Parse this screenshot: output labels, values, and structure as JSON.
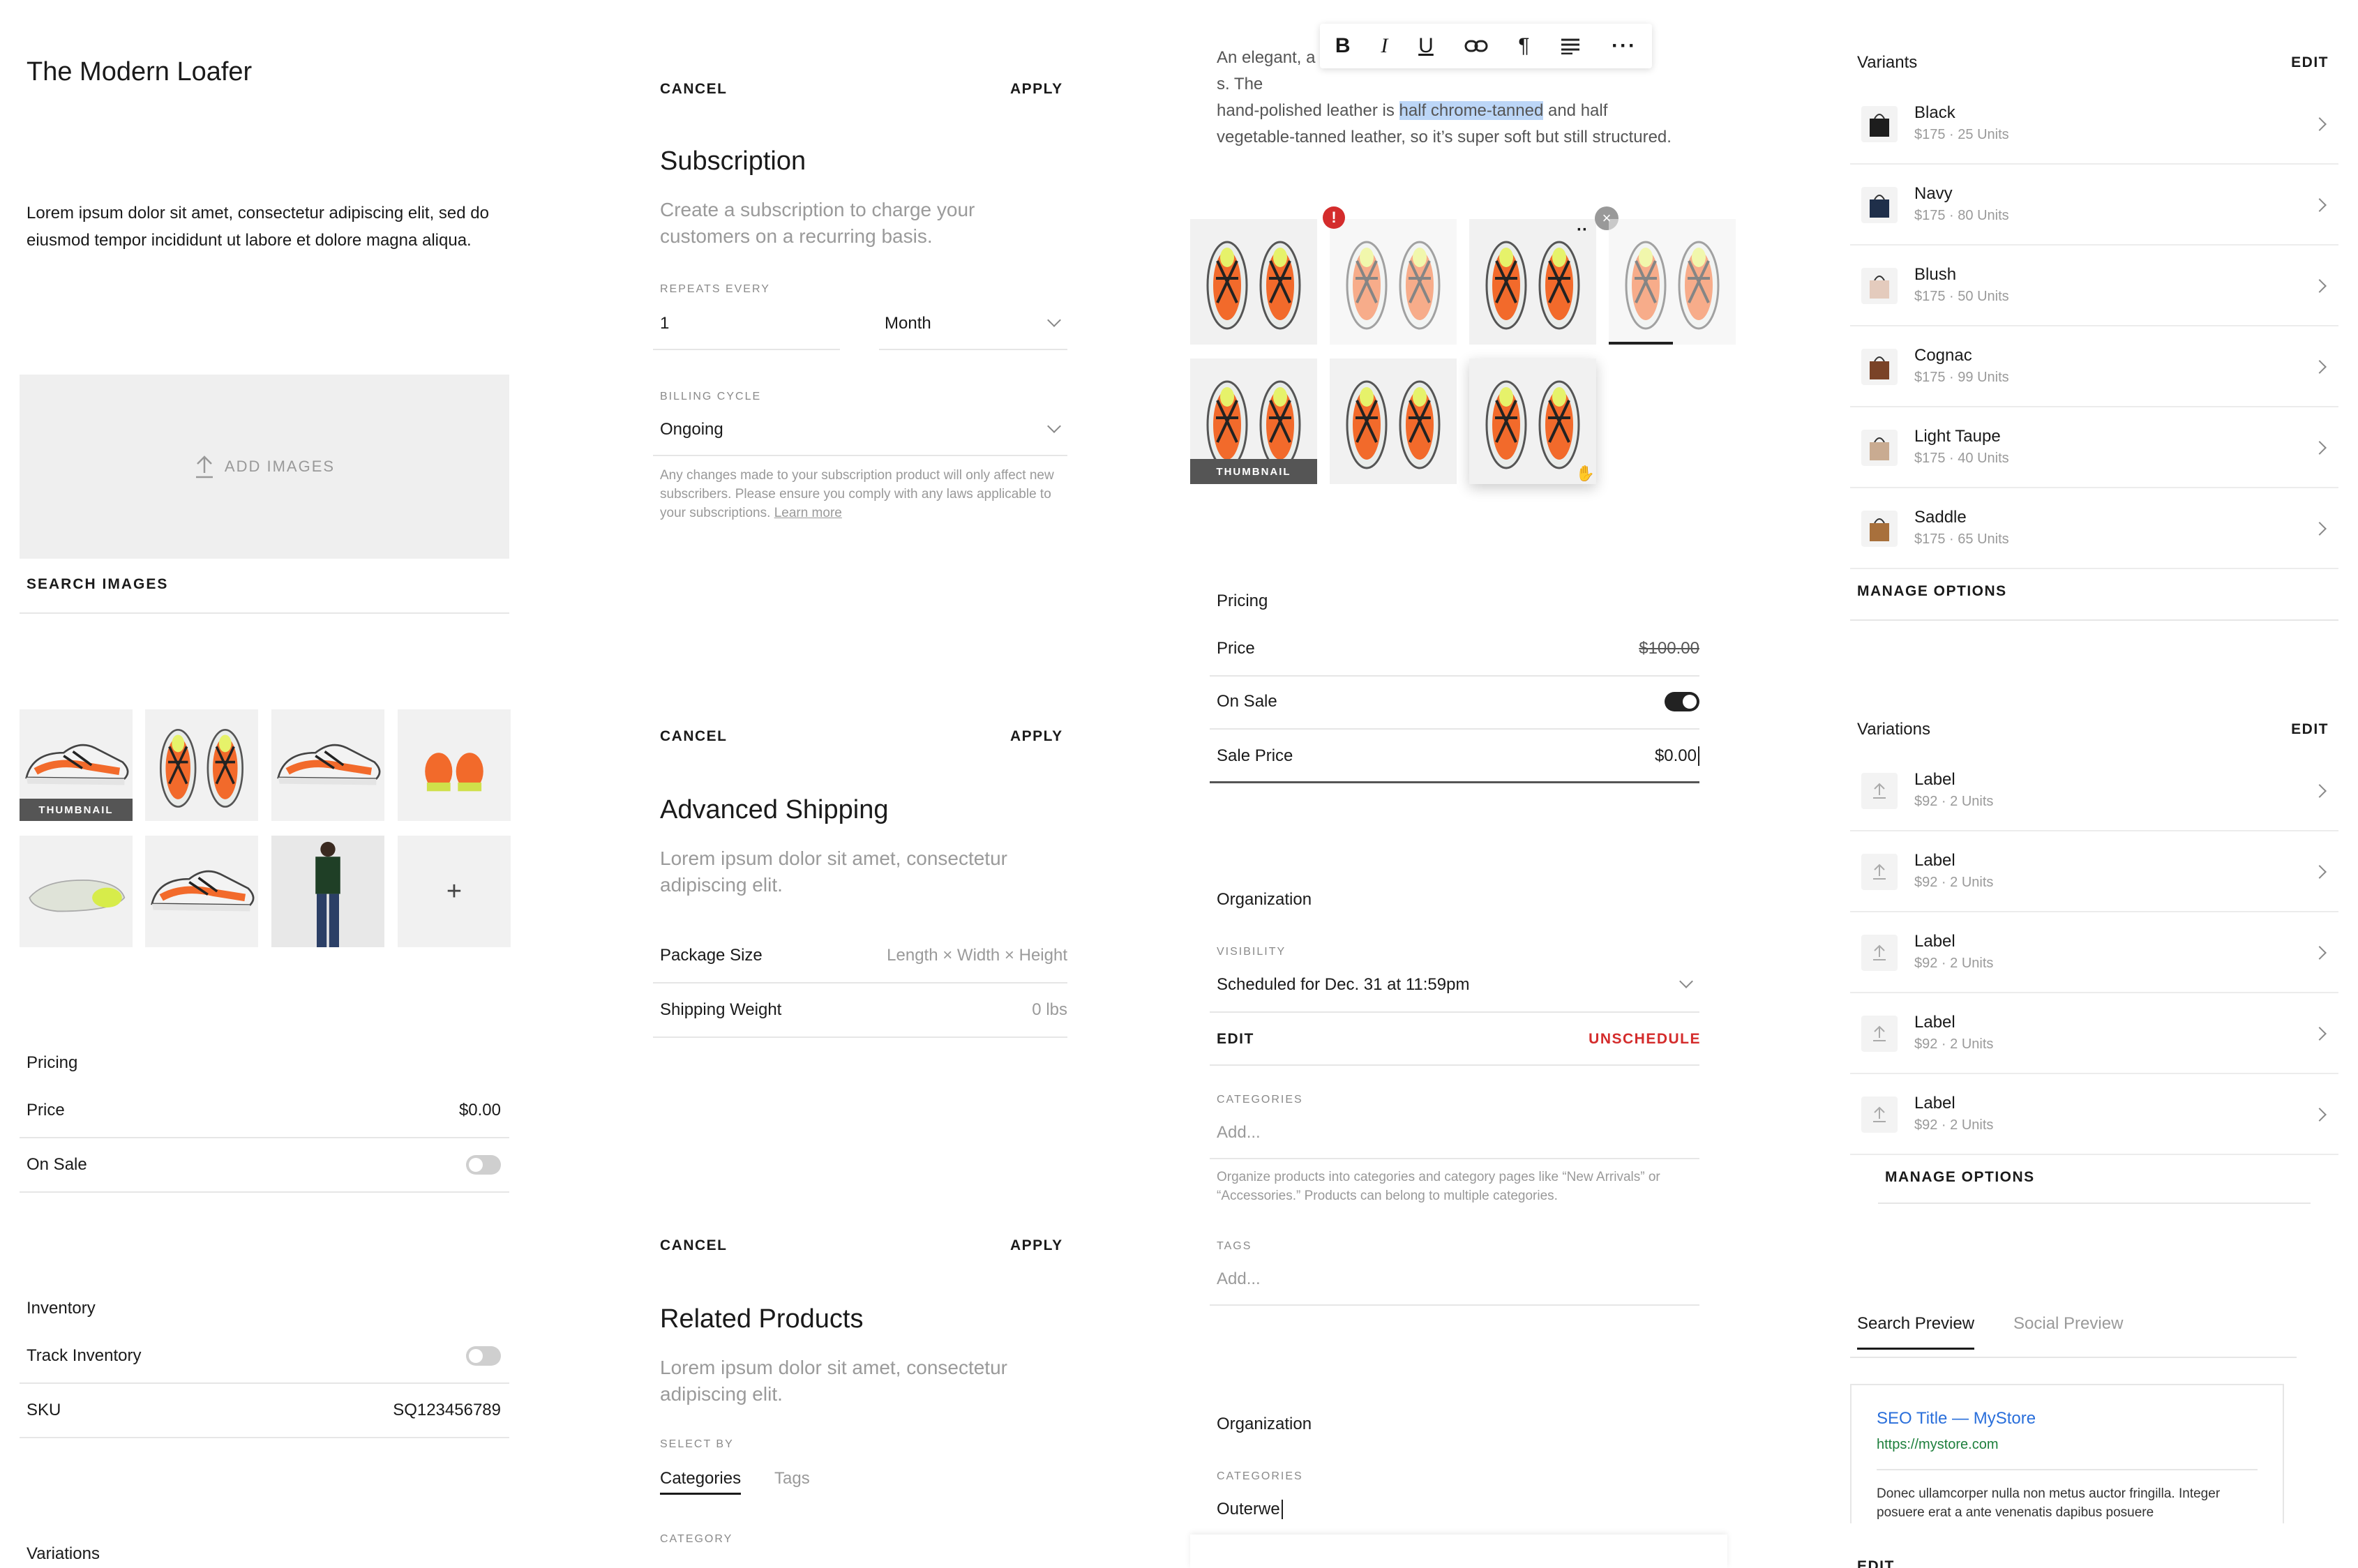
{
  "col1": {
    "title": "The Modern Loafer",
    "description": "Lorem ipsum dolor sit amet, consectetur adipiscing elit, sed do eiusmod tempor incididunt ut labore et dolore magna aliqua.",
    "add_images": "ADD IMAGES",
    "search_images": "SEARCH IMAGES",
    "thumbnail_label": "THUMBNAIL",
    "add_tile": "+",
    "pricing": {
      "heading": "Pricing",
      "price_label": "Price",
      "price_value": "$0.00",
      "on_sale_label": "On Sale",
      "on_sale": false
    },
    "inventory": {
      "heading": "Inventory",
      "track_label": "Track Inventory",
      "track": false,
      "sku_label": "SKU",
      "sku_value": "SQ123456789"
    },
    "variations_heading": "Variations"
  },
  "col2": {
    "subscription": {
      "cancel": "CANCEL",
      "apply": "APPLY",
      "title": "Subscription",
      "subtitle": "Create a subscription to charge your customers on a recurring basis.",
      "repeats_label": "REPEATS EVERY",
      "repeats_value": "1",
      "period": "Month",
      "billing_label": "BILLING CYCLE",
      "billing_value": "Ongoing",
      "notice": "Any changes made to your subscription product will only affect new subscribers. Please ensure you comply with any laws applicable to your subscriptions.",
      "learn_more": "Learn more"
    },
    "shipping": {
      "cancel": "CANCEL",
      "apply": "APPLY",
      "title": "Advanced Shipping",
      "subtitle": "Lorem ipsum dolor sit amet, consectetur adipiscing elit.",
      "package_label": "Package Size",
      "package_placeholder": "Length × Width × Height",
      "weight_label": "Shipping Weight",
      "weight_placeholder": "0 lbs"
    },
    "related": {
      "cancel": "CANCEL",
      "apply": "APPLY",
      "title": "Related Products",
      "subtitle": "Lorem ipsum dolor sit amet, consectetur adipiscing elit.",
      "select_by_label": "SELECT BY",
      "tabs": [
        "Categories",
        "Tags"
      ],
      "category_label": "CATEGORY"
    }
  },
  "col3": {
    "editor": {
      "text_before": "An elegant, a",
      "text_mid1": "s. The",
      "line2_before": "hand-polished leather is ",
      "highlight": "half chrome-tanned",
      "line2_after": " and half",
      "line3": "vegetable-tanned leather, so it’s super soft but still structured.",
      "toolbar": [
        "bold-icon",
        "italic-icon",
        "underline-icon",
        "link-icon",
        "paragraph-icon",
        "align-icon",
        "more-icon"
      ]
    },
    "gallery": {
      "thumbnail_label": "THUMBNAIL",
      "error_badge": "!"
    },
    "pricing": {
      "heading": "Pricing",
      "price_label": "Price",
      "price_value": "$100.00",
      "on_sale_label": "On Sale",
      "on_sale": true,
      "sale_label": "Sale Price",
      "sale_value": "$0.00"
    },
    "organization": {
      "heading": "Organization",
      "visibility_label": "VISIBILITY",
      "visibility_value": "Scheduled for Dec. 31 at 11:59pm",
      "edit": "EDIT",
      "unschedule": "UNSCHEDULE",
      "categories_label": "CATEGORIES",
      "categories_placeholder": "Add...",
      "categories_help": "Organize products into categories and category pages like “New Arrivals” or “Accessories.” Products can belong to multiple categories.",
      "tags_label": "TAGS",
      "tags_placeholder": "Add..."
    },
    "organization2": {
      "heading": "Organization",
      "categories_label": "CATEGORIES",
      "categories_value": "Outerwe"
    }
  },
  "col4": {
    "variants": {
      "heading": "Variants",
      "edit": "EDIT",
      "items": [
        {
          "name": "Black",
          "meta": "$175 · 25 Units",
          "color": "#1d1d1d"
        },
        {
          "name": "Navy",
          "meta": "$175 · 80 Units",
          "color": "#1f2f4a"
        },
        {
          "name": "Blush",
          "meta": "$175 · 50 Units",
          "color": "#e4cbbd"
        },
        {
          "name": "Cognac",
          "meta": "$175 · 99 Units",
          "color": "#7a4327"
        },
        {
          "name": "Light Taupe",
          "meta": "$175 · 40 Units",
          "color": "#c9ab91"
        },
        {
          "name": "Saddle",
          "meta": "$175 · 65 Units",
          "color": "#a8703c"
        }
      ],
      "manage": "MANAGE OPTIONS"
    },
    "variations": {
      "heading": "Variations",
      "edit": "EDIT",
      "items": [
        {
          "name": "Label",
          "meta": "$92 · 2 Units"
        },
        {
          "name": "Label",
          "meta": "$92 · 2 Units"
        },
        {
          "name": "Label",
          "meta": "$92 · 2 Units"
        },
        {
          "name": "Label",
          "meta": "$92 · 2 Units"
        },
        {
          "name": "Label",
          "meta": "$92 · 2 Units"
        }
      ],
      "manage": "MANAGE OPTIONS"
    },
    "seo": {
      "tabs": [
        "Search Preview",
        "Social Preview"
      ],
      "title": "SEO Title — MyStore",
      "url": "https://mystore.com",
      "description": "Donec ullamcorper nulla non metus auctor fringilla. Integer posuere erat a ante venenatis dapibus posuere",
      "edit": "EDIT"
    }
  },
  "colors": {
    "accent_blue": "#2a6fdb",
    "danger": "#d42c2c",
    "seo_green": "#1d7f3c",
    "highlight": "#bcd6f7"
  }
}
